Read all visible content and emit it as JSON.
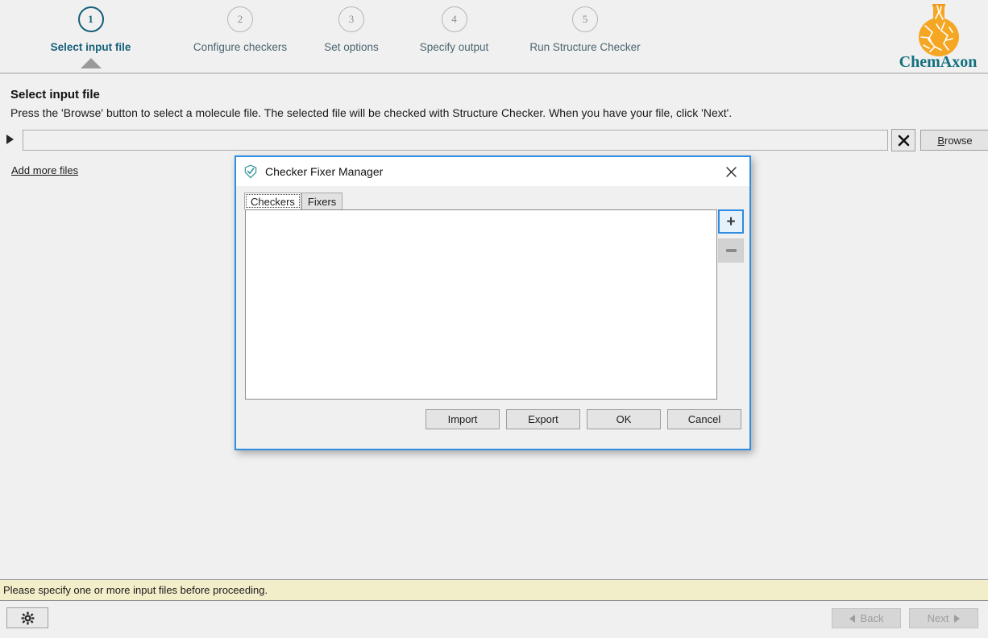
{
  "wizard": {
    "steps": [
      {
        "number": "1",
        "label": "Select input file",
        "active": true
      },
      {
        "number": "2",
        "label": "Configure checkers",
        "active": false
      },
      {
        "number": "3",
        "label": "Set options",
        "active": false
      },
      {
        "number": "4",
        "label": "Specify output",
        "active": false
      },
      {
        "number": "5",
        "label": "Run Structure Checker",
        "active": false
      }
    ],
    "logo_text": "ChemAxon",
    "logo_icon": "chemaxon-flask-logo",
    "accent_color": "#17607a",
    "logo_orange": "#f5a623",
    "logo_teal": "#14707f"
  },
  "page": {
    "title": "Select input file",
    "subtitle": "Press the 'Browse' button to select a molecule file. The selected file will be checked with Structure Checker. When you have your file, click 'Next'.",
    "file_input_value": "",
    "file_input_placeholder": "",
    "clear_label": "✕",
    "browse_label_pre": "",
    "browse_accel": "B",
    "browse_label_post": "rowse",
    "add_more_files_label": "Add more files",
    "expand_icon": "expand-triangle-icon"
  },
  "dialog": {
    "title": "Checker Fixer Manager",
    "icon": "shield-check-icon",
    "close_label": "✕",
    "tabs": [
      {
        "label": "Checkers",
        "selected": true
      },
      {
        "label": "Fixers",
        "selected": false
      }
    ],
    "list_items": [],
    "add_button_label": "+",
    "remove_button_label": "−",
    "buttons": [
      {
        "label": "Import"
      },
      {
        "label": "Export"
      },
      {
        "label": "OK"
      },
      {
        "label": "Cancel"
      }
    ],
    "border_color": "#2e8de0"
  },
  "status": {
    "message": "Please specify one or more input files before proceeding.",
    "background_color": "#f2eeca"
  },
  "footer": {
    "settings_icon": "gear-icon",
    "back_label": "Back",
    "next_label": "Next",
    "back_enabled": false,
    "next_enabled": false
  }
}
